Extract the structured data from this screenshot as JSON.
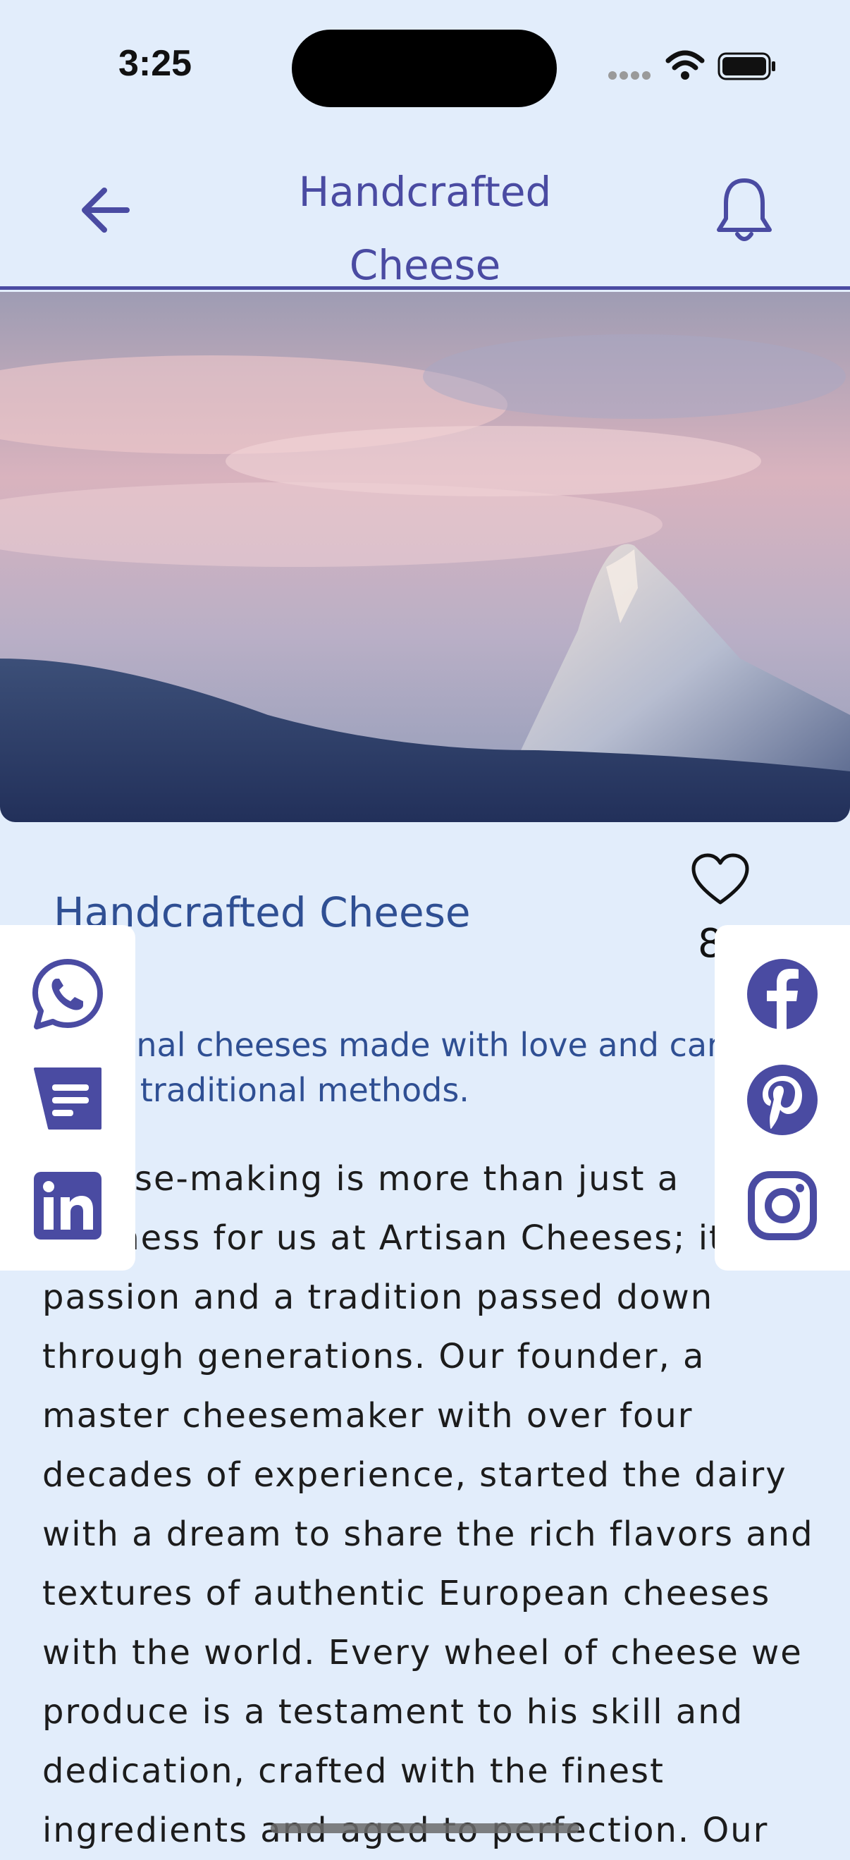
{
  "status_bar": {
    "time": "3:25"
  },
  "header": {
    "title": "Handcrafted Cheese",
    "back_icon": "arrow-left-icon",
    "bell_icon": "bell-icon"
  },
  "article": {
    "title": "Handcrafted Cheese",
    "like_count": "8",
    "subtitle": "Artisanal cheeses made with love and care using traditional methods.",
    "body": "Cheese-making is more than just a business for us at Artisan Cheeses; it's a passion and a tradition passed down through generations. Our founder, a master cheesemaker with over four decades of experience, started the dairy with a dream to share the rich flavors and textures of authentic European cheeses with the world. Every wheel of cheese we produce is a testament to his skill and dedication, crafted with the finest ingredients and aged to perfection. Our"
  },
  "share": {
    "left": [
      "whatsapp-icon",
      "message-icon",
      "linkedin-icon"
    ],
    "right": [
      "facebook-icon",
      "pinterest-icon",
      "instagram-icon"
    ]
  },
  "colors": {
    "background": "#E2EDFB",
    "accent": "#4A4BA2",
    "title_text": "#2F4F93"
  }
}
